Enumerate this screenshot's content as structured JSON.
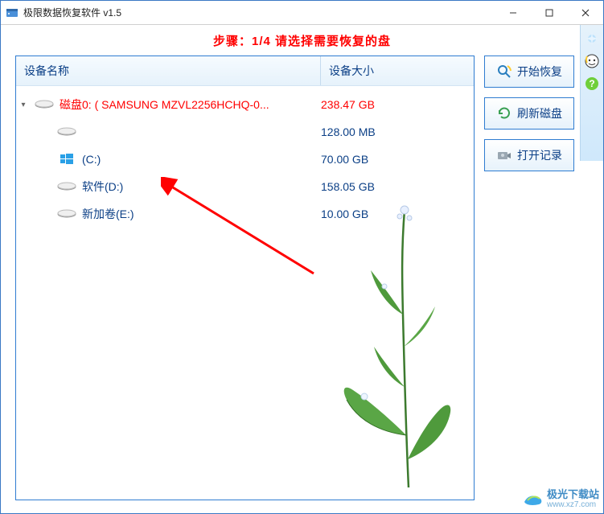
{
  "window": {
    "title": "极限数据恢复软件 v1.5"
  },
  "step": {
    "banner": "步骤：1/4 请选择需要恢复的盘"
  },
  "columns": {
    "name": "设备名称",
    "size": "设备大小"
  },
  "devices": [
    {
      "label": "磁盘0: ( SAMSUNG MZVL2256HCHQ-0...",
      "size": "238.47 GB",
      "root": true,
      "icon": "hdd"
    },
    {
      "label": "",
      "size": "128.00 MB",
      "root": false,
      "icon": "hdd"
    },
    {
      "label": "(C:)",
      "size": "70.00 GB",
      "root": false,
      "icon": "winvol"
    },
    {
      "label": "软件(D:)",
      "size": "158.05 GB",
      "root": false,
      "icon": "hdd"
    },
    {
      "label": "新加卷(E:)",
      "size": "10.00 GB",
      "root": false,
      "icon": "hdd"
    }
  ],
  "actions": {
    "start": "开始恢复",
    "refresh": "刷新磁盘",
    "log": "打开记录"
  },
  "watermark": {
    "name": "极光下载站",
    "url": "www.xz7.com"
  }
}
